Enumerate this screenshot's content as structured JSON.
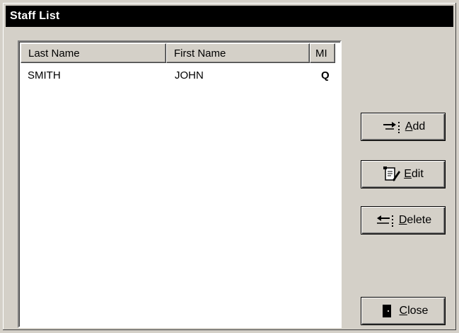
{
  "window": {
    "title": "Staff List"
  },
  "table": {
    "columns": [
      "Last Name",
      "First Name",
      "MI"
    ],
    "rows": [
      {
        "last_name": "SMITH",
        "first_name": "JOHN",
        "mi": "Q"
      }
    ]
  },
  "buttons": {
    "add": {
      "mnemonic": "A",
      "rest": "dd",
      "icon": "add-arrow-icon"
    },
    "edit": {
      "mnemonic": "E",
      "rest": "dit",
      "icon": "edit-document-icon"
    },
    "delete": {
      "mnemonic": "D",
      "rest": "elete",
      "icon": "delete-arrow-icon"
    },
    "close": {
      "mnemonic": "C",
      "rest": "lose",
      "icon": "door-icon"
    }
  }
}
